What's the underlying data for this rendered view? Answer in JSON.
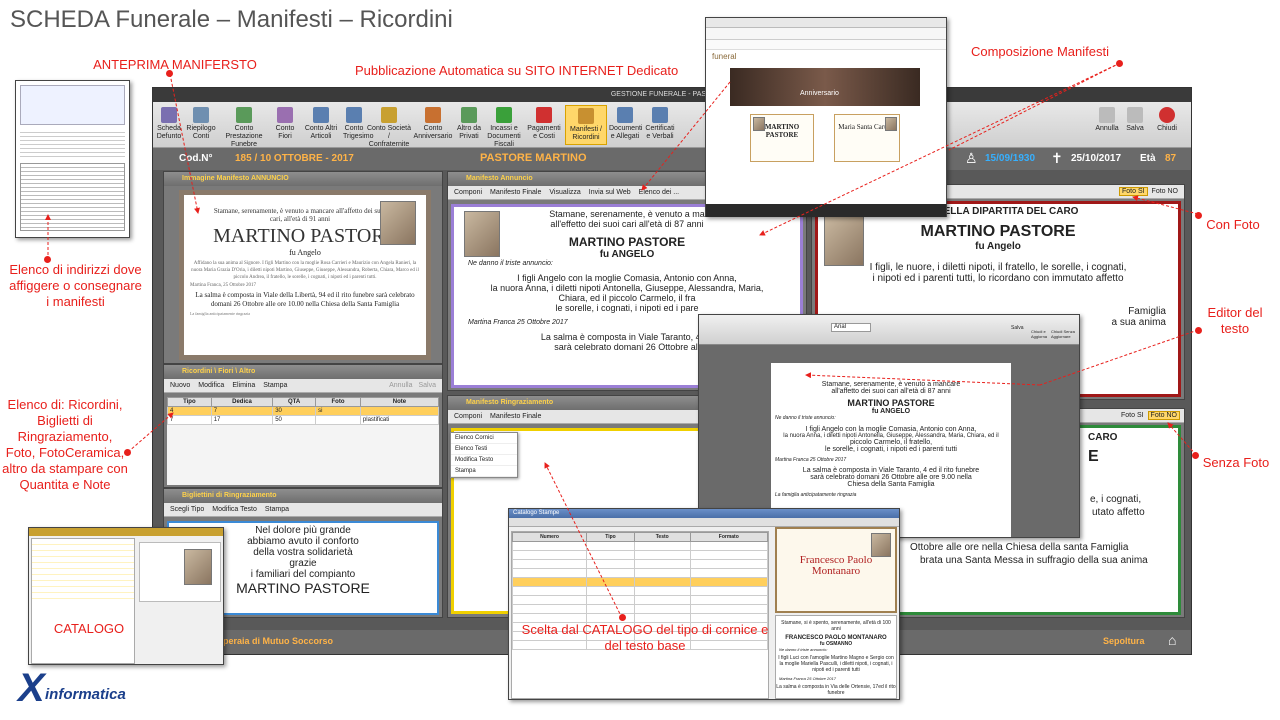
{
  "slide": {
    "title": "SCHEDA Funerale – Manifesti – Ricordini"
  },
  "callouts": {
    "anteprima": "ANTEPRIMA MANIFERSTO",
    "pubblicazione": "Pubblicazione Automatica su SITO INTERNET Dedicato",
    "composizione": "Composizione Manifesti",
    "con_foto": "Con Foto",
    "editor": "Editor del testo",
    "senza_foto": "Senza Foto",
    "elenco_indirizzi": "Elenco di indirizzi dove affiggere o consegnare i manifesti",
    "elenco_ricordini": "Elenco di: Ricordini, Biglietti di Ringraziamento, Foto, FotoCeramica, altro da stampare con Quantita e Note",
    "catalogo": "CATALOGO",
    "scelta_catalogo": "Scelta dal CATALOGO del tipo di cornice e del testo base"
  },
  "logo": {
    "mark": "X",
    "text": "informatica"
  },
  "app": {
    "window_title": "GESTIONE FUNERALE - PASTORE M",
    "ribbon": [
      {
        "label": "Scheda Defunto",
        "color": "#7a6fb0"
      },
      {
        "label": "Riepilogo Conti",
        "color": "#6f8fb0"
      },
      {
        "label": "Conto Prestazione Funebre",
        "color": "#5a9a5a"
      },
      {
        "label": "Conto Fiori",
        "color": "#9a6fb0"
      },
      {
        "label": "Conto Altri Articoli",
        "color": "#5a7fb0"
      },
      {
        "label": "Conto Trigesimo",
        "color": "#5a7fb0"
      },
      {
        "label": "Conto Società / Confraternite",
        "color": "#c8a030"
      },
      {
        "label": "Conto Anniversario",
        "color": "#c87030"
      },
      {
        "label": "Altro da Privati",
        "color": "#5a9a5a"
      },
      {
        "label": "Incassi e Documenti Fiscali",
        "color": "#3aa03a"
      },
      {
        "label": "Pagamenti e Costi",
        "color": "#d03030"
      },
      {
        "label": "Manifesti / Ricordini",
        "color": "#c89030"
      },
      {
        "label": "Documenti e Allegati",
        "color": "#5a7fb0"
      },
      {
        "label": "Certificati e Verbali",
        "color": "#5a7fb0"
      }
    ],
    "ribbon_right": [
      {
        "label": "Annulla"
      },
      {
        "label": "Salva"
      },
      {
        "label": "Chiudi"
      }
    ],
    "infobar": {
      "cod_label": "Cod.N°",
      "cod_value": "185 / 10 OTTOBRE - 2017",
      "name": "PASTORE MARTINO",
      "birth_date": "15/09/1930",
      "death_date": "25/10/2017",
      "eta_label": "Età",
      "eta_value": "87"
    },
    "anteprima_panel": {
      "title": "Immagine Manifesto ANNUNCIO"
    },
    "manifesto_preview": {
      "intro": "Stamane, serenamente, è venuto a mancare all'affetto dei suoi cari, all'età di 91 anni",
      "name": "MARTINO PASTORE",
      "sub": "fu Angelo",
      "body": "Affidano la sua anima al Signore. I figli Martino con la moglie Rosa Carrieri e Maurizio con Angela Ranieri, la nuora Maria Grazia D'Oria, i diletti nipoti Martino, Giuseppe, Giuseppe, Alessandra, Roberta, Chiara, Marco ed il piccolo Andrea, il fratello, le sorelle, i cognati, i nipoti ed i parenti tutti.",
      "place": "Martina Franca, 25 Ottobre 2017",
      "salma": "La salma è composta in Viale della Libertà, 94 ed il rito funebre sarà celebrato domani 26 Ottobre alle ore 10.00 nella Chiesa della Santa Famiglia",
      "footer": "La famiglia anticipatamente ringrazia"
    },
    "ricordini_panel": {
      "title": "Ricordini \\ Fiori \\ Altro",
      "toolbar": [
        "Nuovo",
        "Modifica",
        "Elimina",
        "Stampa"
      ],
      "toolbar_right": [
        "Annulla",
        "Salva"
      ],
      "columns": [
        "Tipo",
        "Dedica",
        "QTA",
        "Foto",
        "Note"
      ],
      "rows": [
        [
          "4",
          "7",
          "30",
          "si",
          ""
        ],
        [
          "7",
          "17",
          "50",
          "",
          "plastificati"
        ]
      ]
    },
    "biglietti_panel": {
      "title": "Bigliettini di Ringraziamento",
      "toolbar": [
        "Scegli Tipo",
        "Modifica Testo",
        "Stampa"
      ],
      "text_lines": [
        "Nel dolore più grande",
        "abbiamo avuto il conforto",
        "della vostra solidarietà",
        "grazie",
        "i familiari del compianto"
      ],
      "name": "MARTINO PASTORE"
    },
    "annuncio_panel": {
      "title": "Manifesto Annuncio",
      "toolbar": [
        "Componi",
        "Manifesto Finale",
        "Visualizza",
        "Invia sul Web",
        "Elenco dei ..."
      ],
      "intro1": "Stamane, serenamente, è venuto a ma",
      "intro2": "all'effetto dei suoi cari all'età di 87 anni",
      "name": "MARTINO PASTORE",
      "sub": "fu ANGELO",
      "annuncio": "Ne danno il triste annuncio:",
      "body1": "I figli Angelo con la moglie Comasia, Antonio con Anna,",
      "body2": "la nuora Anna, i diletti nipoti Antonella, Giuseppe, Alessandra, Maria,",
      "body3": "Chiara, ed il piccolo Carmelo, il fra",
      "body4": "le sorelle, i cognati, i nipoti ed i pare",
      "place": "Martina Franca 25 Ottobre 2017",
      "salma1": "La salma è composta in Viale Taranto, 4 ed",
      "salma2": "sarà celebrato domani 26 Ottobre all"
    },
    "ringraziamento_panel": {
      "title": "Manifesto Ringraziamento",
      "toolbar": [
        "Componi",
        "Manifesto Finale"
      ],
      "menu": [
        "Elenco Cornici",
        "Elenco Testi",
        "Modifica Testo",
        "Stampa"
      ]
    },
    "right_top": {
      "toolbar": [
        "Foto SI",
        "Foto NO"
      ],
      "heading": "MO DELLA DIPARTITA DEL CARO",
      "name": "MARTINO PASTORE",
      "sub": "fu Angelo",
      "body1": "I figli, le nuore, i diletti nipoti, il fratello, le sorelle, i cognati,",
      "body2": "i nipoti ed i parenti tutti, lo ricordano con immutato affetto",
      "frag1": "Famiglia",
      "frag2": "a sua anima"
    },
    "right_bottom": {
      "toolbar": [
        "Foto SI",
        "Foto NO"
      ],
      "heading": "CARO",
      "initial": "E",
      "frag1": "e, i cognati,",
      "frag2": "utato affetto",
      "line1": "Ottobre alle ore nella Chiesa della santa Famiglia",
      "line2": "brata una Santa Messa in suffragio della sua anima"
    },
    "bottom_bar": {
      "left": "peraia di Mutuo Soccorso",
      "right": "Sepoltura"
    }
  },
  "web_shot": {
    "site_name": "funeral",
    "banner": "Anniversario",
    "card1_name": "MARTINO PASTORE",
    "card2_name": "Maria Santa Carucci"
  },
  "editor_shot": {
    "font": "Arial",
    "ribbon_right": [
      "Salva",
      "Chiudi e Aggiorna",
      "Chiudi Senza Aggiornare"
    ],
    "intro1": "Stamane, serenamente, è venuto a mancare",
    "intro2": "all'affetto dei suoi cari all'età di 87 anni",
    "name": "MARTINO PASTORE",
    "sub": "fu ANGELO",
    "annuncio": "Ne danno il triste annuncio:",
    "body1": "I figli Angelo con la moglie Comasia, Antonio con Anna,",
    "body2": "la nuora Anna, i diletti nipoti Antonella, Giuseppe, Alessandra, Maria, Chiara, ed il",
    "body3": "piccolo Carmelo, il fratello,",
    "body4": "le sorelle, i cognati, i nipoti ed i parenti tutti",
    "place": "Martina Franca 25 Ottobre 2017",
    "salma1": "La salma è composta in Viale Taranto, 4 ed il rito funebre",
    "salma2": "sarà celebrato domani 26 Ottobre alle ore 9.00 nella",
    "salma3": "Chiesa della Santa Famiglia",
    "footer": "La famiglia anticipatamente ringrazia"
  },
  "catalog_shot": {
    "title": "Catalogo Stampe",
    "columns": [
      "Numero",
      "Tipo",
      "Testo",
      "Formato"
    ],
    "preview_name": "Francesco Paolo Montanaro",
    "text_intro": "Stamane, si è spento, serenamente, all'età di 100 anni",
    "text_name": "FRANCESCO PAOLO MONTANARO",
    "text_sub": "fu OSMANNO",
    "text_annuncio": "Ne danno il triste annuncio:",
    "text_body": "I figli Luci con l'amoglie Martino Magno e Sergio con la moglie Mariella Pasculli, i diletti nipoti, i cognati, i nipoti ed i parenti tutti",
    "text_place": "Martina Franca 25 Ottobre 2017",
    "text_salma": "La salma è composta in Via delle Ortensie, 17ed il rito funebre"
  }
}
